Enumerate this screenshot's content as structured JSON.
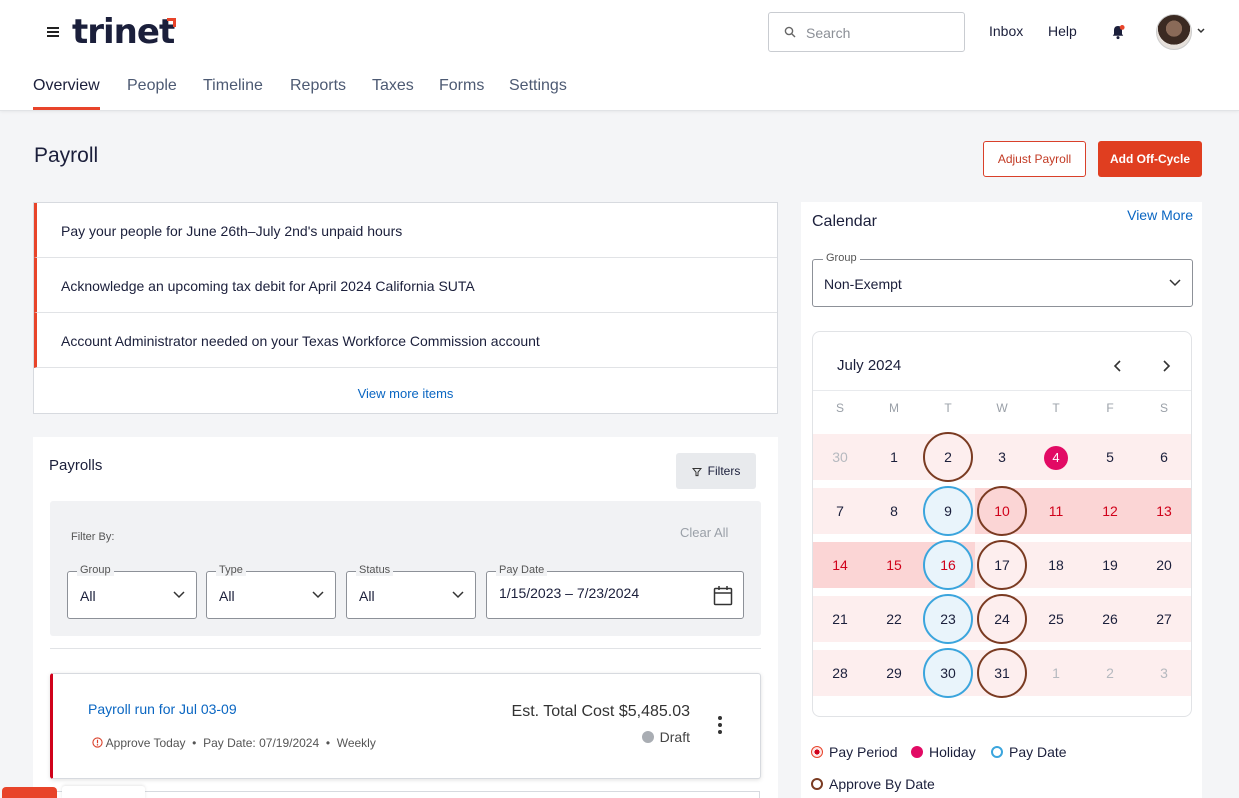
{
  "header": {
    "logo": "trinet",
    "search_placeholder": "Search",
    "inbox": "Inbox",
    "help": "Help"
  },
  "tabs": [
    "Overview",
    "People",
    "Timeline",
    "Reports",
    "Taxes",
    "Forms",
    "Settings"
  ],
  "active_tab": "Overview",
  "page": {
    "title": "Payroll",
    "adjust_button": "Adjust Payroll",
    "offcycle_button": "Add Off-Cycle"
  },
  "alerts": {
    "items": [
      "Pay your people for June 26th–July 2nd's unpaid hours",
      "Acknowledge an upcoming tax debit for April 2024 California SUTA",
      "Account Administrator needed on your Texas Workforce Commission account"
    ],
    "view_more": "View more items"
  },
  "payrolls": {
    "title": "Payrolls",
    "filters_button": "Filters",
    "filter_by": "Filter By:",
    "clear_all": "Clear All",
    "filters": [
      {
        "label": "Group",
        "value": "All"
      },
      {
        "label": "Type",
        "value": "All"
      },
      {
        "label": "Status",
        "value": "All"
      }
    ],
    "pay_date": {
      "label": "Pay Date",
      "value": "1/15/2023 – 7/23/2024"
    },
    "run": {
      "title": "Payroll run for Jul 03-09",
      "approve": "Approve Today",
      "pay_date": "Pay Date: 07/19/2024",
      "frequency": "Weekly",
      "cost": "Est. Total Cost $5,485.03",
      "status": "Draft"
    }
  },
  "calendar": {
    "title": "Calendar",
    "view_more": "View More",
    "group_label": "Group",
    "group_value": "Non-Exempt",
    "month": "July 2024",
    "weekdays": [
      "S",
      "M",
      "T",
      "W",
      "T",
      "F",
      "S"
    ],
    "weeks": [
      [
        {
          "d": "30",
          "muted": true
        },
        {
          "d": "1"
        },
        {
          "d": "2",
          "ring": "brown"
        },
        {
          "d": "3"
        },
        {
          "d": "4",
          "holiday": true
        },
        {
          "d": "5"
        },
        {
          "d": "6"
        }
      ],
      [
        {
          "d": "7"
        },
        {
          "d": "8"
        },
        {
          "d": "9",
          "ring": "blue"
        },
        {
          "d": "10",
          "ring": "brown",
          "red": true
        },
        {
          "d": "11",
          "red": true
        },
        {
          "d": "12",
          "red": true
        },
        {
          "d": "13",
          "red": true
        }
      ],
      [
        {
          "d": "14",
          "red": true
        },
        {
          "d": "15",
          "red": true
        },
        {
          "d": "16",
          "ring": "blue",
          "red": true
        },
        {
          "d": "17",
          "ring": "brown"
        },
        {
          "d": "18"
        },
        {
          "d": "19"
        },
        {
          "d": "20"
        }
      ],
      [
        {
          "d": "21"
        },
        {
          "d": "22"
        },
        {
          "d": "23",
          "ring": "blue"
        },
        {
          "d": "24",
          "ring": "brown"
        },
        {
          "d": "25"
        },
        {
          "d": "26"
        },
        {
          "d": "27"
        }
      ],
      [
        {
          "d": "28"
        },
        {
          "d": "29"
        },
        {
          "d": "30",
          "ring": "blue"
        },
        {
          "d": "31",
          "ring": "brown"
        },
        {
          "d": "1",
          "muted": true
        },
        {
          "d": "2",
          "muted": true
        },
        {
          "d": "3",
          "muted": true
        }
      ]
    ],
    "legend": {
      "pay_period": "Pay Period",
      "holiday": "Holiday",
      "pay_date": "Pay Date",
      "approve_by": "Approve By Date"
    }
  },
  "colors": {
    "accent": "#e8442a",
    "link": "#0a66c2",
    "holiday": "#e20a64",
    "pay_date_ring": "#3ba5dd",
    "approve_ring": "#7a3b22"
  }
}
